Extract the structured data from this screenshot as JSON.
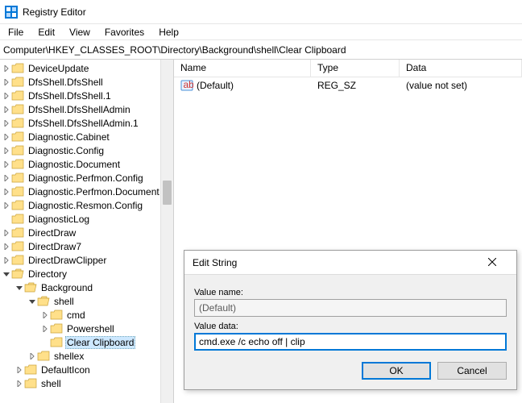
{
  "titlebar": {
    "title": "Registry Editor"
  },
  "menu": {
    "file": "File",
    "edit": "Edit",
    "view": "View",
    "favorites": "Favorites",
    "help": "Help"
  },
  "addressbar": {
    "path": "Computer\\HKEY_CLASSES_ROOT\\Directory\\Background\\shell\\Clear Clipboard"
  },
  "tree": {
    "items": [
      {
        "indent": 1,
        "exp": "r",
        "open": false,
        "label": "DeviceUpdate"
      },
      {
        "indent": 1,
        "exp": "r",
        "open": false,
        "label": "DfsShell.DfsShell"
      },
      {
        "indent": 1,
        "exp": "r",
        "open": false,
        "label": "DfsShell.DfsShell.1"
      },
      {
        "indent": 1,
        "exp": "r",
        "open": false,
        "label": "DfsShell.DfsShellAdmin"
      },
      {
        "indent": 1,
        "exp": "r",
        "open": false,
        "label": "DfsShell.DfsShellAdmin.1"
      },
      {
        "indent": 1,
        "exp": "r",
        "open": false,
        "label": "Diagnostic.Cabinet"
      },
      {
        "indent": 1,
        "exp": "r",
        "open": false,
        "label": "Diagnostic.Config"
      },
      {
        "indent": 1,
        "exp": "r",
        "open": false,
        "label": "Diagnostic.Document"
      },
      {
        "indent": 1,
        "exp": "r",
        "open": false,
        "label": "Diagnostic.Perfmon.Config"
      },
      {
        "indent": 1,
        "exp": "r",
        "open": false,
        "label": "Diagnostic.Perfmon.Document"
      },
      {
        "indent": 1,
        "exp": "r",
        "open": false,
        "label": "Diagnostic.Resmon.Config"
      },
      {
        "indent": 1,
        "exp": "",
        "open": false,
        "label": "DiagnosticLog"
      },
      {
        "indent": 1,
        "exp": "r",
        "open": false,
        "label": "DirectDraw"
      },
      {
        "indent": 1,
        "exp": "r",
        "open": false,
        "label": "DirectDraw7"
      },
      {
        "indent": 1,
        "exp": "r",
        "open": false,
        "label": "DirectDrawClipper"
      },
      {
        "indent": 1,
        "exp": "d",
        "open": true,
        "label": "Directory"
      },
      {
        "indent": 2,
        "exp": "d",
        "open": true,
        "label": "Background"
      },
      {
        "indent": 3,
        "exp": "d",
        "open": true,
        "label": "shell"
      },
      {
        "indent": 4,
        "exp": "r",
        "open": false,
        "label": "cmd"
      },
      {
        "indent": 4,
        "exp": "r",
        "open": false,
        "label": "Powershell"
      },
      {
        "indent": 4,
        "exp": "",
        "open": false,
        "label": "Clear Clipboard",
        "selected": true
      },
      {
        "indent": 3,
        "exp": "r",
        "open": false,
        "label": "shellex"
      },
      {
        "indent": 2,
        "exp": "r",
        "open": false,
        "label": "DefaultIcon"
      },
      {
        "indent": 2,
        "exp": "r",
        "open": false,
        "label": "shell"
      }
    ]
  },
  "list": {
    "headers": {
      "name": "Name",
      "type": "Type",
      "data": "Data"
    },
    "rows": [
      {
        "name": "(Default)",
        "type": "REG_SZ",
        "data": "(value not set)"
      }
    ]
  },
  "dialog": {
    "title": "Edit String",
    "value_name_label": "Value name:",
    "value_name": "(Default)",
    "value_data_label": "Value data:",
    "value_data": "cmd.exe /c echo off | clip",
    "ok": "OK",
    "cancel": "Cancel"
  }
}
